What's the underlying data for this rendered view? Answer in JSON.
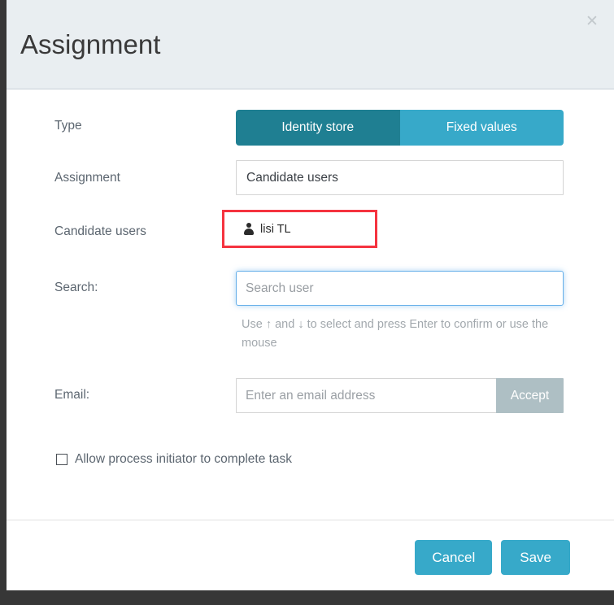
{
  "dialog": {
    "title": "Assignment",
    "close_icon": "close-icon"
  },
  "form": {
    "type": {
      "label": "Type",
      "options": [
        "Identity store",
        "Fixed values"
      ],
      "selected": "Identity store",
      "active_color": "#1f7f92",
      "inactive_color": "#37a9c9"
    },
    "assignment": {
      "label": "Assignment",
      "value": "Candidate users"
    },
    "candidate_users": {
      "label": "Candidate users",
      "highlight_color": "#f5333f",
      "users": [
        {
          "icon": "person-icon",
          "name": "lisi TL"
        }
      ]
    },
    "search": {
      "label": "Search:",
      "value": "",
      "placeholder": "Search user",
      "help": "Use ↑ and ↓ to select and press Enter to confirm or use the mouse"
    },
    "email": {
      "label": "Email:",
      "value": "",
      "placeholder": "Enter an email address",
      "accept_label": "Accept"
    },
    "allow_initiator": {
      "label": "Allow process initiator to complete task",
      "checked": false
    }
  },
  "footer": {
    "cancel_label": "Cancel",
    "save_label": "Save"
  }
}
